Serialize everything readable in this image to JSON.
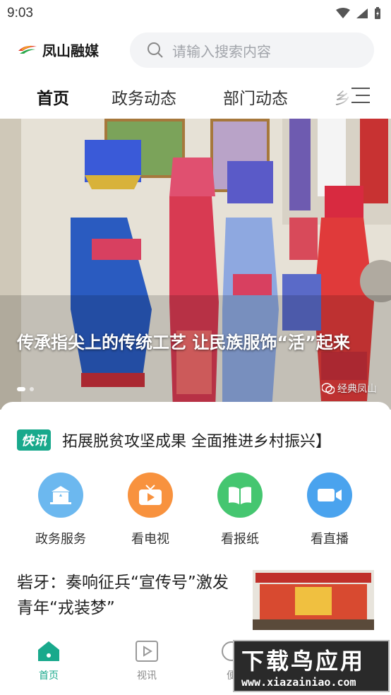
{
  "status_bar": {
    "time": "9:03"
  },
  "header": {
    "logo_text": "凤山融媒",
    "search_placeholder": "请输入搜索内容"
  },
  "nav": {
    "tabs": [
      "首页",
      "政务动态",
      "部门动态",
      "乡"
    ],
    "active_index": 0
  },
  "banner": {
    "caption": "传承指尖上的传统工艺 让民族服饰“活”起来",
    "watermark": "经典凤山"
  },
  "flash": {
    "badge": "快讯",
    "text": "拓展脱贫攻坚成果 全面推进乡村振兴】"
  },
  "services": [
    {
      "label": "政务服务",
      "icon": "government-icon",
      "color": "#5aaee8"
    },
    {
      "label": "看电视",
      "icon": "tv-icon",
      "color": "#f58a3c"
    },
    {
      "label": "看报纸",
      "icon": "newspaper-icon",
      "color": "#3cc06a"
    },
    {
      "label": "看直播",
      "icon": "live-camera-icon",
      "color": "#3e9be8"
    }
  ],
  "news": {
    "headline": "砦牙：奏响征兵“宣传号”激发青年“戎装梦”"
  },
  "tabbar": {
    "tabs": [
      {
        "label": "首页",
        "icon": "home-icon"
      },
      {
        "label": "视讯",
        "icon": "video-icon"
      },
      {
        "label": "便",
        "icon": "service-icon"
      }
    ],
    "active_index": 0
  },
  "watermark": {
    "title": "下载鸟应用",
    "url": "www.xiazainiao.com"
  },
  "colors": {
    "accent": "#19a98c"
  }
}
